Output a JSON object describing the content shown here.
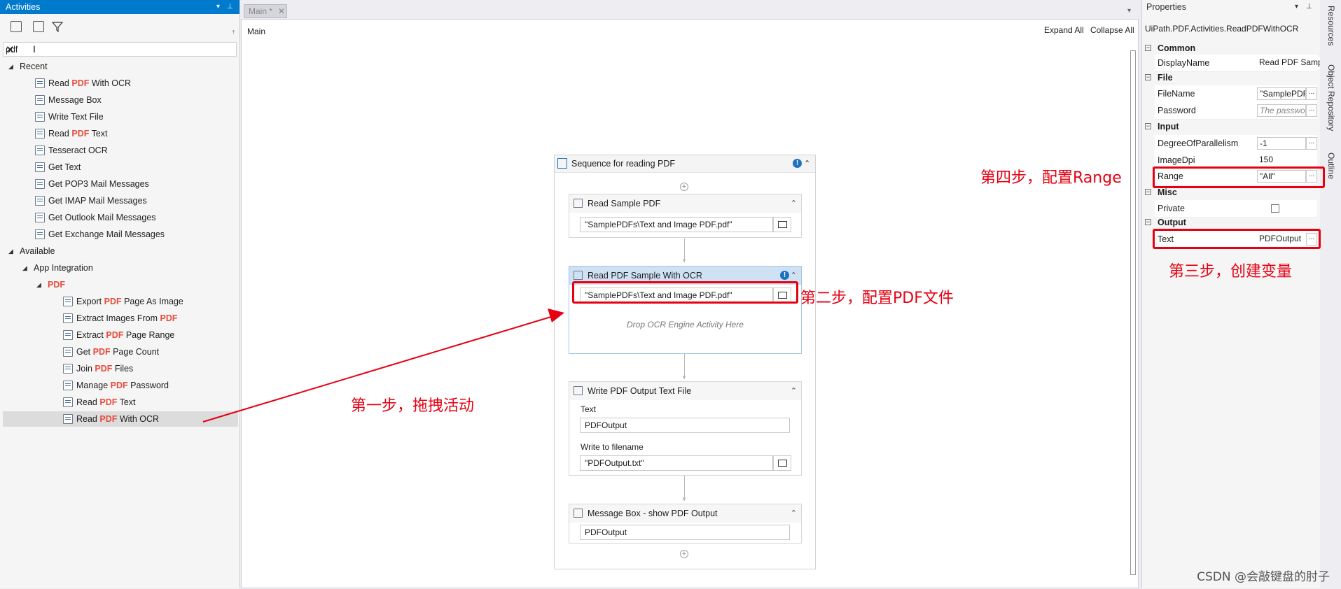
{
  "activities_panel": {
    "title": "Activities",
    "search_value": "pdf",
    "sections": {
      "recent": "Recent",
      "available": "Available",
      "app_integration": "App Integration",
      "pdf": "PDF"
    },
    "recent_items": [
      {
        "pre": "Read ",
        "hl": "PDF",
        "post": " With OCR"
      },
      {
        "pre": "Message Box",
        "hl": "",
        "post": ""
      },
      {
        "pre": "Write Text File",
        "hl": "",
        "post": ""
      },
      {
        "pre": "Read ",
        "hl": "PDF",
        "post": " Text"
      },
      {
        "pre": "Tesseract OCR",
        "hl": "",
        "post": ""
      },
      {
        "pre": "Get Text",
        "hl": "",
        "post": ""
      },
      {
        "pre": "Get POP3 Mail Messages",
        "hl": "",
        "post": ""
      },
      {
        "pre": "Get IMAP Mail Messages",
        "hl": "",
        "post": ""
      },
      {
        "pre": "Get Outlook Mail Messages",
        "hl": "",
        "post": ""
      },
      {
        "pre": "Get Exchange Mail Messages",
        "hl": "",
        "post": ""
      }
    ],
    "pdf_items": [
      {
        "pre": "Export ",
        "hl": "PDF",
        "post": " Page As Image"
      },
      {
        "pre": "Extract Images From ",
        "hl": "PDF",
        "post": ""
      },
      {
        "pre": "Extract ",
        "hl": "PDF",
        "post": " Page Range"
      },
      {
        "pre": "Get ",
        "hl": "PDF",
        "post": " Page Count"
      },
      {
        "pre": "Join ",
        "hl": "PDF",
        "post": " Files"
      },
      {
        "pre": "Manage ",
        "hl": "PDF",
        "post": " Password"
      },
      {
        "pre": "Read ",
        "hl": "PDF",
        "post": " Text"
      },
      {
        "pre": "Read ",
        "hl": "PDF",
        "post": " With OCR"
      }
    ]
  },
  "designer": {
    "tab_label": "Main *",
    "breadcrumb": "Main",
    "expand_all": "Expand All",
    "collapse_all": "Collapse All",
    "sequence_title": "Sequence for reading PDF",
    "read_sample": {
      "title": "Read Sample PDF",
      "file": "\"SamplePDFs\\Text and Image PDF.pdf\""
    },
    "read_ocr": {
      "title": "Read PDF Sample With OCR",
      "file": "\"SamplePDFs\\Text and Image PDF.pdf\"",
      "drop_hint": "Drop OCR Engine Activity Here"
    },
    "write_output": {
      "title": "Write PDF Output Text File",
      "text_label": "Text",
      "text_value": "PDFOutput",
      "filename_label": "Write to filename",
      "filename_value": "\"PDFOutput.txt\""
    },
    "message_box": {
      "title": "Message Box - show PDF Output",
      "value": "PDFOutput"
    }
  },
  "properties": {
    "title": "Properties",
    "type_name": "UiPath.PDF.Activities.ReadPDFWithOCR",
    "categories": {
      "common": "Common",
      "file": "File",
      "input": "Input",
      "misc": "Misc",
      "output": "Output"
    },
    "rows": {
      "display_name": {
        "name": "DisplayName",
        "value": "Read PDF Sample"
      },
      "file_name": {
        "name": "FileName",
        "value": "\"SamplePDF"
      },
      "password": {
        "name": "Password",
        "value": "The passwo"
      },
      "degree": {
        "name": "DegreeOfParallelism",
        "value": "-1"
      },
      "image_dpi": {
        "name": "ImageDpi",
        "value": "150"
      },
      "range": {
        "name": "Range",
        "value": "\"All\""
      },
      "private": {
        "name": "Private",
        "value": ""
      },
      "text": {
        "name": "Text",
        "value": "PDFOutput"
      }
    },
    "dots": "..."
  },
  "side_tabs": [
    "Resources",
    "Object Repository",
    "Outline"
  ],
  "annotations": {
    "step1": "第一步，拖拽活动",
    "step2": "第二步，配置PDF文件",
    "step3": "第三步，创建变量",
    "step4": "第四步，配置Range"
  },
  "watermark": "CSDN @会敲键盘的肘子",
  "colors": {
    "accent": "#007acc",
    "highlight": "#e74c3c",
    "annotation": "#e60012"
  }
}
